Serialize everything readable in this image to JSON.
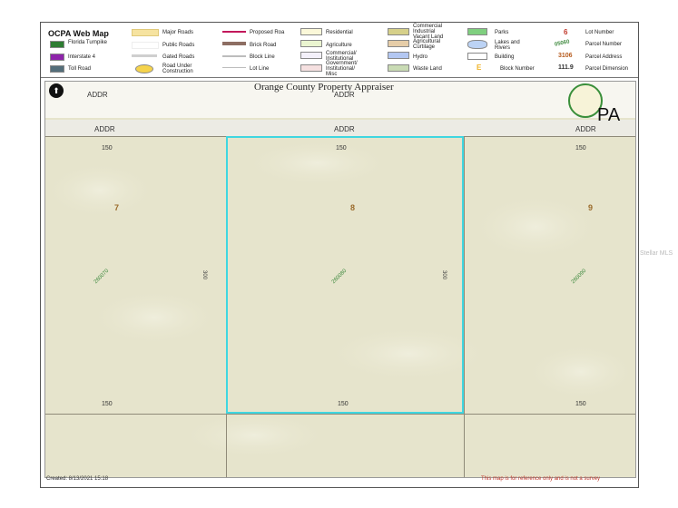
{
  "legend": {
    "title": "OCPA Web Map",
    "items": [
      {
        "label": "Florida Turnpike",
        "color": "#2e7d32"
      },
      {
        "label": "Interstate 4",
        "color": "#8e24aa"
      },
      {
        "label": "Toll Road",
        "color": "#546e7a"
      },
      {
        "label": "Major Roads",
        "color": "#f6e3a0"
      },
      {
        "label": "Public Roads",
        "color": "#ffffff"
      },
      {
        "label": "Gated Roads",
        "color": "#cfcfcf"
      },
      {
        "label": "Road Under\nConstruction",
        "color": "#f5d34c"
      },
      {
        "label": "Proposed Roa",
        "color": "#c2185b"
      },
      {
        "label": "Brick Road",
        "color": "#8d6e63"
      },
      {
        "label": "Block Line",
        "color": "#bdbdbd"
      },
      {
        "label": "Lot Line",
        "color": "#bdbdbd"
      },
      {
        "label": "Residential",
        "color": "#fbf8d9"
      },
      {
        "label": "Agriculture",
        "color": "#eaf5d0"
      },
      {
        "label": "Commercial/\nInstitutional",
        "color": "#f3f0fa"
      },
      {
        "label": "Government/\nInstitutional/\nMisc",
        "color": "#f5e0e0"
      },
      {
        "label": "Commercial\nIndustrial\nVacant Land",
        "color": "#d6d08a"
      },
      {
        "label": "Agricultural\nCurtilage",
        "color": "#e6cda8"
      },
      {
        "label": "Hydro",
        "color": "#b3c7f2"
      },
      {
        "label": "Waste Land",
        "color": "#c9dbb4"
      },
      {
        "label": "Parks",
        "color": "#7fcf7f"
      },
      {
        "label": "Lakes and\nRivers",
        "color": "#bcd3f5"
      },
      {
        "label": "Building",
        "color": "#ffffff"
      },
      {
        "label": "Block Number",
        "color": "#f0b428"
      },
      {
        "label": "Lot Number",
        "sample": "6"
      },
      {
        "label": "Parcel Number",
        "sample": "05060"
      },
      {
        "label": "Parcel Address",
        "sample": "3106"
      },
      {
        "label": "Parcel Dimension",
        "sample": "111.9"
      }
    ]
  },
  "map": {
    "title": "Orange County Property Appraiser",
    "pa_label": "PA",
    "road_labels": [
      "ADDR",
      "ADDR",
      "ADDR",
      "ADDR",
      "ADDR",
      "ADDR"
    ],
    "lots": [
      {
        "number": "7",
        "parcel": "260070",
        "top_dim": "150",
        "bottom_dim": "150",
        "side_dim": "300"
      },
      {
        "number": "8",
        "parcel": "260080",
        "top_dim": "150",
        "bottom_dim": "150",
        "side_dim": "300"
      },
      {
        "number": "9",
        "parcel": "260090",
        "top_dim": "150",
        "bottom_dim": "150"
      }
    ],
    "selected_lot": "8",
    "created": "Created: 8/13/2021 15:18",
    "disclaimer": "This map is for reference only and is not a survey",
    "watermark": "Stellar MLS",
    "colors": {
      "selection": "#3fd6e0",
      "lot_number": "#9a6a2a",
      "parcel_number": "#3f8a3f",
      "disclaimer": "#c0392b"
    }
  }
}
